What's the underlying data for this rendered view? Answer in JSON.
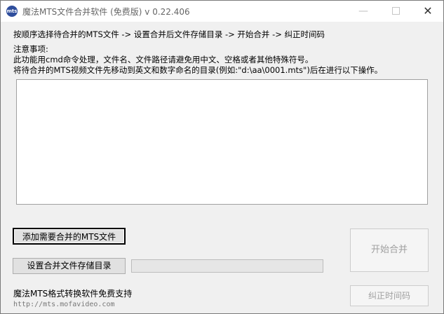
{
  "window": {
    "title": "魔法MTS文件合并软件 (免费版) v 0.22.406",
    "icon_text": "mts",
    "controls": {
      "minimize": "—",
      "close": "✕"
    }
  },
  "instructions": {
    "steps": "按顺序选择待合并的MTS文件 -> 设置合并后文件存储目录  -> 开始合并 -> 纠正时间码",
    "notice_title": "注意事项:",
    "notice_1": "此功能用cmd命令处理，文件名、文件路径请避免用中文、空格或者其他特殊符号。",
    "notice_2": "将待合并的MTS视频文件先移动到英文和数字命名的目录(例如:\"d:\\aa\\0001.mts\")后在进行以下操作。"
  },
  "buttons": {
    "add_files": "添加需要合并的MTS文件",
    "set_output_dir": "设置合并文件存储目录",
    "start_merge": "开始合并",
    "fix_timecode": "纠正时间码"
  },
  "progress": {
    "value": 0
  },
  "footer": {
    "support_text": "魔法MTS格式转换软件免费支持",
    "url": "http://mts.mofavideo.com"
  },
  "colors": {
    "progress_fill": "#06b025",
    "app_icon": "#2f4e9d"
  }
}
